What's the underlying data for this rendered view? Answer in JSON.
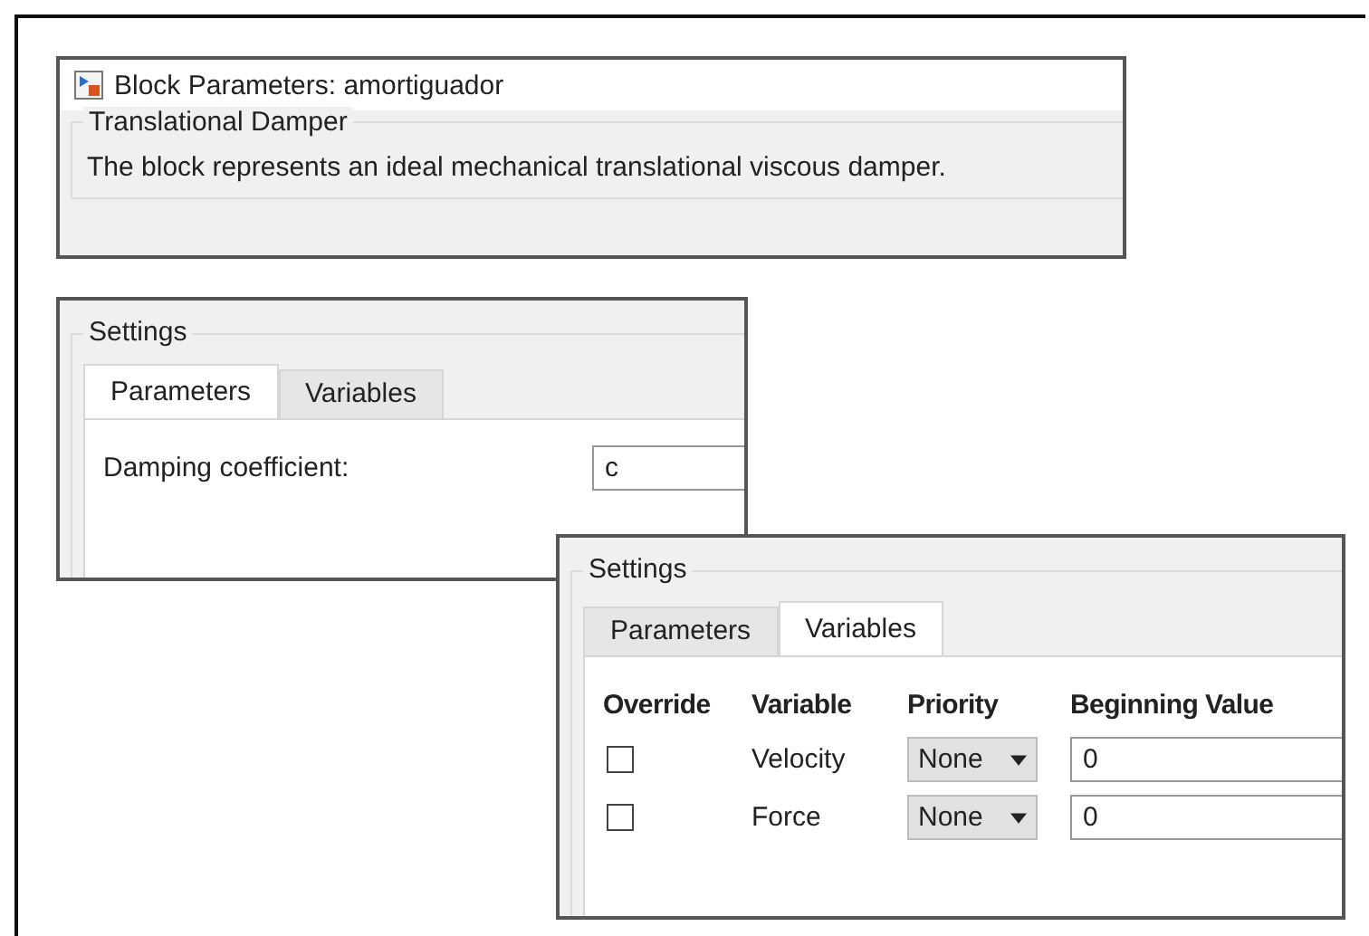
{
  "dialog": {
    "title": "Block Parameters: amortiguador",
    "group_title": "Translational Damper",
    "description": "The block represents an ideal mechanical translational viscous damper."
  },
  "panels": [
    {
      "kind": "parameters",
      "title": "Settings",
      "tabs": [
        {
          "label": "Parameters",
          "selected": true
        },
        {
          "label": "Variables",
          "selected": false
        }
      ],
      "parameters": [
        {
          "label": "Damping coefficient:",
          "value": "c"
        }
      ]
    },
    {
      "kind": "variables",
      "title": "Settings",
      "tabs": [
        {
          "label": "Parameters",
          "selected": false
        },
        {
          "label": "Variables",
          "selected": true
        }
      ],
      "columns": [
        "Override",
        "Variable",
        "Priority",
        "Beginning Value"
      ],
      "rows": [
        {
          "checked": false,
          "variable": "Velocity",
          "priority": "None",
          "beginning_value": "0"
        },
        {
          "checked": false,
          "variable": "Force",
          "priority": "None",
          "beginning_value": "0"
        }
      ]
    }
  ]
}
